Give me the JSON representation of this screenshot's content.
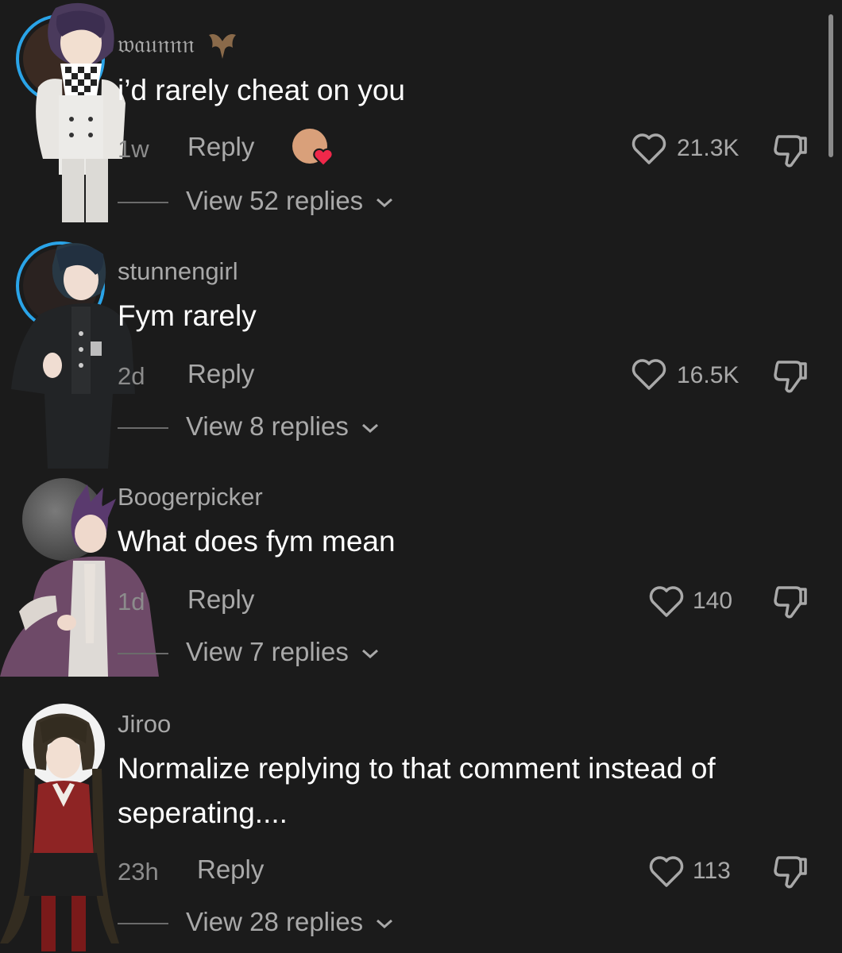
{
  "scrollbar": {
    "color": "#8a8a8a"
  },
  "comments": [
    {
      "username": "𝔴𝔞𝔲𝔫𝔫𝔫",
      "text": "i’d rarely cheat on you",
      "time": "1w",
      "reply_label": "Reply",
      "likes": "21.3K",
      "view_replies": "View 52 replies",
      "username_icon": "bat-icon",
      "creator_liked": true
    },
    {
      "username": "stunnengirl",
      "text": "Fym rarely",
      "time": "2d",
      "reply_label": "Reply",
      "likes": "16.5K",
      "view_replies": "View 8 replies"
    },
    {
      "username": "Boogerpicker",
      "text": "What does fym mean",
      "time": "1d",
      "reply_label": "Reply",
      "likes": "140",
      "view_replies": "View 7 replies"
    },
    {
      "username": "Jiroo",
      "text": "Normalize replying to that comment instead of seperating....",
      "time": "23h",
      "reply_label": "Reply",
      "likes": "113",
      "view_replies": "View 28 replies"
    }
  ],
  "colors": {
    "background": "#1b1b1b",
    "avatar_ring": "#2aa4e8",
    "secondary_text": "#a9a9a9",
    "heart_badge": "#f0284a"
  }
}
